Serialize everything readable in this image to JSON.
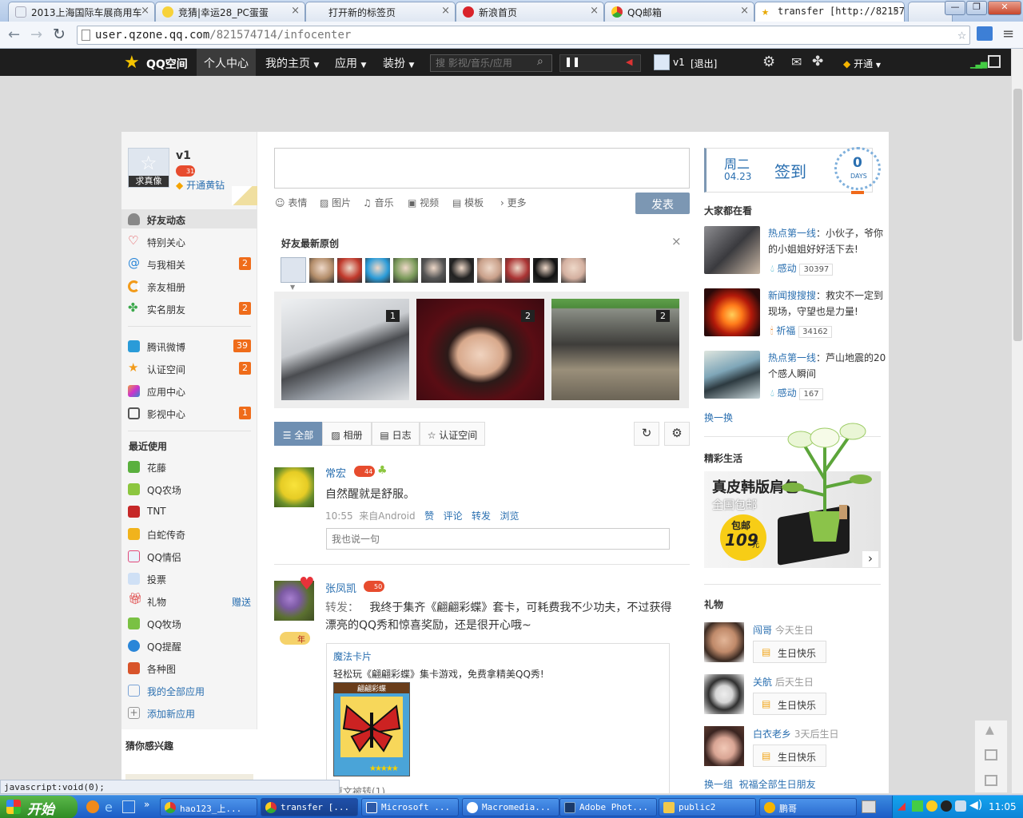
{
  "browser": {
    "tabs": [
      {
        "title": "2013上海国际车展商用车",
        "icon": "page-icon"
      },
      {
        "title": "竞猜|幸运28_PC蛋蛋",
        "icon": "smile-icon"
      },
      {
        "title": "打开新的标签页",
        "icon": "none"
      },
      {
        "title": "新浪首页",
        "icon": "sina-icon"
      },
      {
        "title": "QQ邮箱",
        "icon": "chrome-icon"
      },
      {
        "title": "transfer [http://82157",
        "icon": "star-icon"
      }
    ],
    "url_host": "user.qzone.qq.com",
    "url_path": "/821574714/infocenter",
    "status_text": "javascript:void(0);"
  },
  "qznav": {
    "logo": "QQ空间",
    "items": [
      "个人中心",
      "我的主页",
      "应用",
      "装扮"
    ],
    "search_placeholder": "搜 影视/音乐/应用",
    "user": "v1",
    "logout": "[退出]",
    "open": "开通"
  },
  "profile": {
    "name": "v1",
    "avatar_label": "求真像",
    "level": "31",
    "vip_link": "开通黄钻"
  },
  "leftnav": {
    "group1": [
      {
        "label": "好友动态",
        "badge": ""
      },
      {
        "label": "特别关心",
        "badge": ""
      },
      {
        "label": "与我相关",
        "badge": "2"
      },
      {
        "label": "亲友相册",
        "badge": ""
      },
      {
        "label": "实名朋友",
        "badge": "2"
      }
    ],
    "group2": [
      {
        "label": "腾讯微博",
        "badge": "39"
      },
      {
        "label": "认证空间",
        "badge": "2"
      },
      {
        "label": "应用中心",
        "badge": ""
      },
      {
        "label": "影视中心",
        "badge": "1"
      }
    ],
    "recent_title": "最近使用",
    "recent": [
      {
        "label": "花藤",
        "extra": ""
      },
      {
        "label": "QQ农场",
        "extra": ""
      },
      {
        "label": "TNT",
        "extra": ""
      },
      {
        "label": "白蛇传奇",
        "extra": ""
      },
      {
        "label": "QQ情侣",
        "extra": ""
      },
      {
        "label": "投票",
        "extra": ""
      },
      {
        "label": "礼物",
        "extra": "赠送"
      },
      {
        "label": "QQ牧场",
        "extra": ""
      },
      {
        "label": "QQ提醒",
        "extra": ""
      },
      {
        "label": "各种图",
        "extra": ""
      }
    ],
    "all_apps": "我的全部应用",
    "add_app": "添加新应用",
    "interest_title": "猜你感兴趣"
  },
  "composer": {
    "tools": [
      "表情",
      "图片",
      "音乐",
      "视频",
      "模板",
      "更多"
    ],
    "submit": "发表"
  },
  "friends_new": {
    "title": "好友最新原创",
    "close": "×",
    "photo_counts": [
      "1",
      "2",
      "2"
    ]
  },
  "filter_tabs": [
    "全部",
    "相册",
    "日志",
    "认证空间"
  ],
  "feed": [
    {
      "name": "常宏",
      "level": "44",
      "text": "自然醒就是舒服。",
      "time": "10:55",
      "source": "来自Android",
      "actions": [
        "赞",
        "评论",
        "转发",
        "浏览"
      ],
      "reply_placeholder": "我也说一句"
    },
    {
      "name": "张凤凯",
      "level": "50",
      "years": "年",
      "prefix": "转发：",
      "text": "我终于集齐《翩翩彩蝶》套卡，可耗费我不少功夫，不过获得漂亮的QQ秀和惊喜奖励，还是很开心哦~",
      "card_title": "魔法卡片",
      "card_desc": "轻松玩《翩翩彩蝶》集卡游戏，免费拿精美QQ秀!",
      "card_name": "翩翩彩蝶",
      "footer": "原文被转(1)"
    }
  ],
  "signin": {
    "weekday": "周二",
    "date": "04.23",
    "label": "签到",
    "days": "0",
    "days_unit": "DAYS"
  },
  "hot": {
    "title": "大家都在看",
    "items": [
      {
        "tag": "热点第一线",
        "text": "：小伙子，爷你的小姐姐好好活下去!",
        "reaction": "感动",
        "count": "30397"
      },
      {
        "tag": "新闻搜搜搜",
        "text": "：救灾不一定到现场，守望也是力量!",
        "reaction": "祈福",
        "count": "34162"
      },
      {
        "tag": "热点第一线",
        "text": "：芦山地震的20个感人瞬间",
        "reaction": "感动",
        "count": "167"
      }
    ],
    "refresh": "换一换"
  },
  "life": {
    "title": "精彩生活",
    "ad_line1": "真皮韩版肩包",
    "ad_line2": "全国包邮",
    "ad_badge1": "包邮",
    "ad_badge2": "109",
    "ad_badge3": "元"
  },
  "gifts": {
    "title": "礼物",
    "items": [
      {
        "name": "闯哥",
        "when": "今天生日",
        "btn": "生日快乐"
      },
      {
        "name": "关航",
        "when": "后天生日",
        "btn": "生日快乐"
      },
      {
        "name": "白衣老乡",
        "when": "3天后生日",
        "btn": "生日快乐"
      }
    ],
    "refresh": "换一组",
    "bless_all": "祝福全部生日朋友"
  },
  "taskbar": {
    "start": "开始",
    "buttons": [
      "hao123_上...",
      "transfer [...",
      "Microsoft ...",
      "Macromedia...",
      "Adobe Phot...",
      "public2",
      "鹏哥"
    ],
    "clock": "11:05"
  }
}
